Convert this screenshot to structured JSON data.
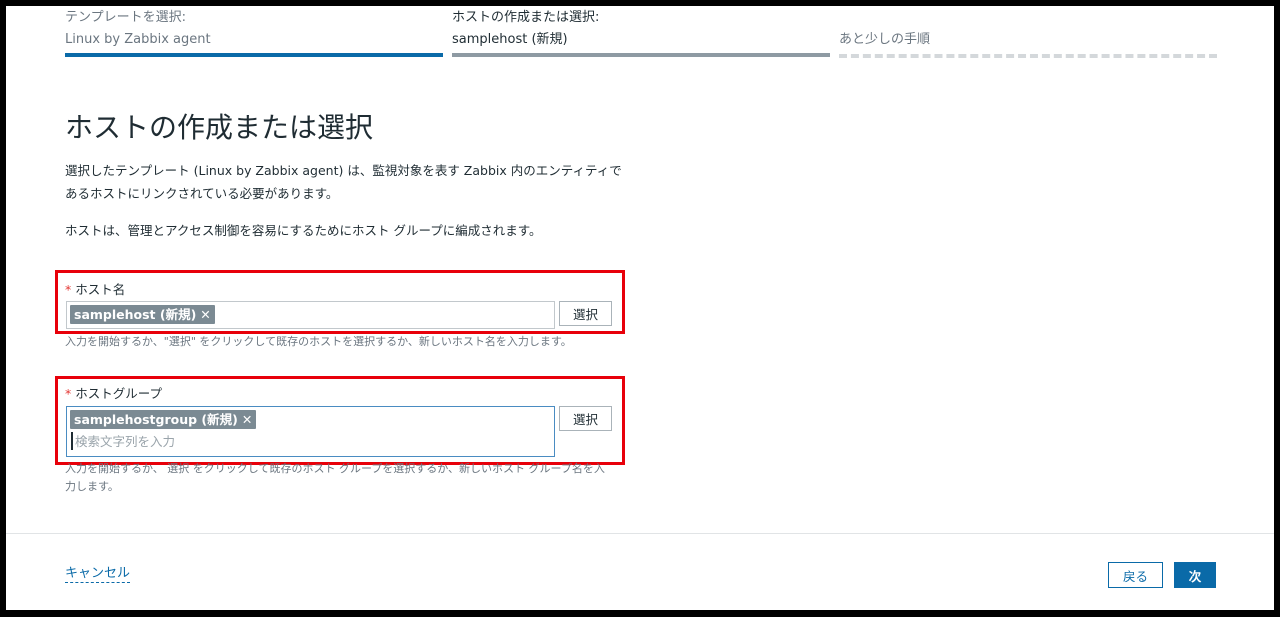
{
  "stepper": {
    "steps": [
      {
        "label": "テンプレートを選択:",
        "value": "Linux by Zabbix agent",
        "state": "done"
      },
      {
        "label": "ホストの作成または選択:",
        "value": "samplehost (新規)",
        "state": "current"
      },
      {
        "label": "あと少しの手順",
        "value": "",
        "state": "todo"
      }
    ]
  },
  "main": {
    "title": "ホストの作成または選択",
    "description": "選択したテンプレート (Linux by Zabbix agent) は、監視対象を表す Zabbix 内のエンティティであるホストにリンクされている必要があります。",
    "description2": "ホストは、管理とアクセス制御を容易にするためにホスト グループに編成されます。"
  },
  "host_field": {
    "required_mark": "*",
    "label": "ホスト名",
    "chip": "samplehost (新規)",
    "chip_remove": "✕",
    "select_button": "選択",
    "hint": "入力を開始するか、\"選択\" をクリックして既存のホストを選択するか、新しいホスト名を入力します。"
  },
  "group_field": {
    "required_mark": "*",
    "label": "ホストグループ",
    "chip": "samplehostgroup (新規)",
    "chip_remove": "✕",
    "placeholder": "検索文字列を入力",
    "select_button": "選択",
    "hint": "入力を開始するか、 選択 をクリックして既存のホスト グループを選択するか、新しいホスト グループ名を入力します。"
  },
  "footer": {
    "cancel": "キャンセル",
    "back": "戻る",
    "next": "次"
  },
  "colors": {
    "accent": "#0a6aa8",
    "highlight": "#e8000a",
    "chip_bg": "#7b8a93"
  }
}
